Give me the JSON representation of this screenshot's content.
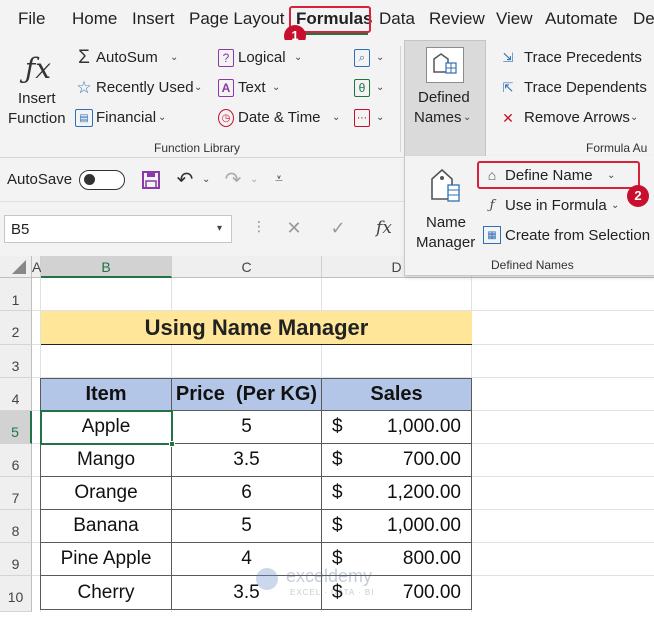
{
  "tabs": [
    "File",
    "Home",
    "Insert",
    "Page Layout",
    "Formulas",
    "Data",
    "Review",
    "View",
    "Automate",
    "De"
  ],
  "badges": {
    "one": "1",
    "two": "2"
  },
  "ribbon": {
    "insert_function": [
      "Insert",
      "Function"
    ],
    "autosum": "AutoSum",
    "recently_used": "Recently Used",
    "financial": "Financial",
    "logical": "Logical",
    "text": "Text",
    "date_time": "Date & Time",
    "function_library": "Function Library",
    "defined_names": [
      "Defined",
      "Names"
    ],
    "trace_precedents": "Trace Precedents",
    "trace_dependents": "Trace Dependents",
    "remove_arrows": "Remove Arrows",
    "formula_auditing": "Formula Au"
  },
  "qat": {
    "autosave": "AutoSave"
  },
  "formula_bar": {
    "name_box": "B5",
    "fx": "fx"
  },
  "defined_names_panel": {
    "name_manager": [
      "Name",
      "Manager"
    ],
    "define_name": "Define Name",
    "use_in_formula": "Use in Formula",
    "create_from_selection": "Create from Selection",
    "group_label": "Defined Names"
  },
  "sheet": {
    "columns": [
      "A",
      "B",
      "C",
      "D"
    ],
    "rows": [
      "1",
      "2",
      "3",
      "4",
      "5",
      "6",
      "7",
      "8",
      "9",
      "10"
    ],
    "title": "Using Name Manager",
    "headers": [
      "Item",
      "Price  (Per KG)",
      "Sales"
    ],
    "currency": "$",
    "data": [
      [
        "Apple",
        "5",
        "1,000.00"
      ],
      [
        "Mango",
        "3.5",
        "700.00"
      ],
      [
        "Orange",
        "6",
        "1,200.00"
      ],
      [
        "Banana",
        "5",
        "1,000.00"
      ],
      [
        "Pine Apple",
        "4",
        "800.00"
      ],
      [
        "Cherry",
        "3.5",
        "700.00"
      ]
    ]
  },
  "watermark": {
    "name": "exceldemy",
    "tag": "EXCEL · DATA · BI"
  },
  "colors": {
    "accent_green": "#217346",
    "header_blue": "#b4c6e7",
    "title_yellow": "#ffe699",
    "highlight_red": "#d6223a"
  }
}
